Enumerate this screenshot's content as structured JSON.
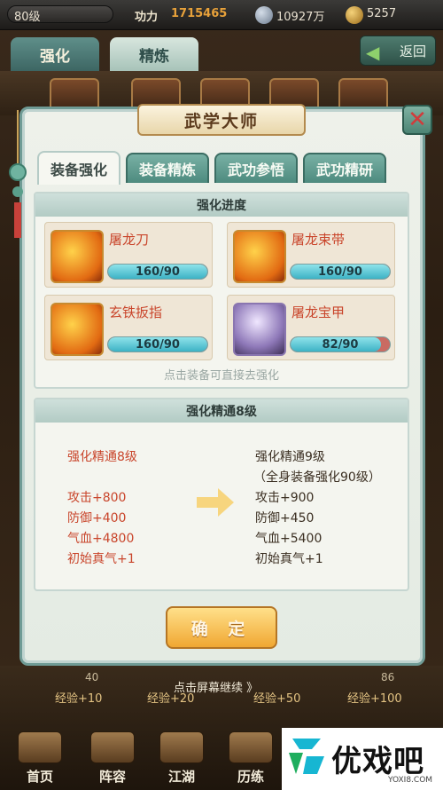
{
  "status_bar": {
    "level": "80级",
    "power_label": "功力",
    "power_value": "1715465",
    "silver": "10927万",
    "gold": "5257"
  },
  "background_tabs": {
    "tab1": "强化",
    "tab2": "精炼",
    "back": "返回"
  },
  "dialog": {
    "title": "武学大师",
    "tabs": [
      "装备强化",
      "装备精炼",
      "武功参悟",
      "武功精研"
    ],
    "progress_section": {
      "header": "强化进度",
      "items": [
        {
          "name": "屠龙刀",
          "progress": "160/90",
          "fill": 1.0
        },
        {
          "name": "屠龙束带",
          "progress": "160/90",
          "fill": 1.0
        },
        {
          "name": "玄铁扳指",
          "progress": "160/90",
          "fill": 1.0
        },
        {
          "name": "屠龙宝甲",
          "progress": "82/90",
          "fill": 0.91
        }
      ],
      "hint": "点击装备可直接去强化"
    },
    "mastery_section": {
      "header": "强化精通8级",
      "current": {
        "title": "强化精通8级",
        "attack": "攻击+800",
        "defense": "防御+400",
        "hp": "气血+4800",
        "qi": "初始真气+1"
      },
      "next": {
        "title": "强化精通9级",
        "requirement": "（全身装备强化90级）",
        "attack": "攻击+900",
        "defense": "防御+450",
        "hp": "气血+5400",
        "qi": "初始真气+1"
      }
    },
    "confirm": "确 定"
  },
  "bottom": {
    "exp": [
      "经验+10",
      "经验+20",
      "经验+50",
      "经验+100"
    ],
    "exp_nums": [
      "40",
      "",
      "",
      "86"
    ],
    "continue": "点击屏幕继续 》",
    "nav": [
      "首页",
      "阵容",
      "江湖",
      "历练"
    ],
    "logo_text": "优戏吧",
    "logo_sub": "YOXI8.COM"
  }
}
